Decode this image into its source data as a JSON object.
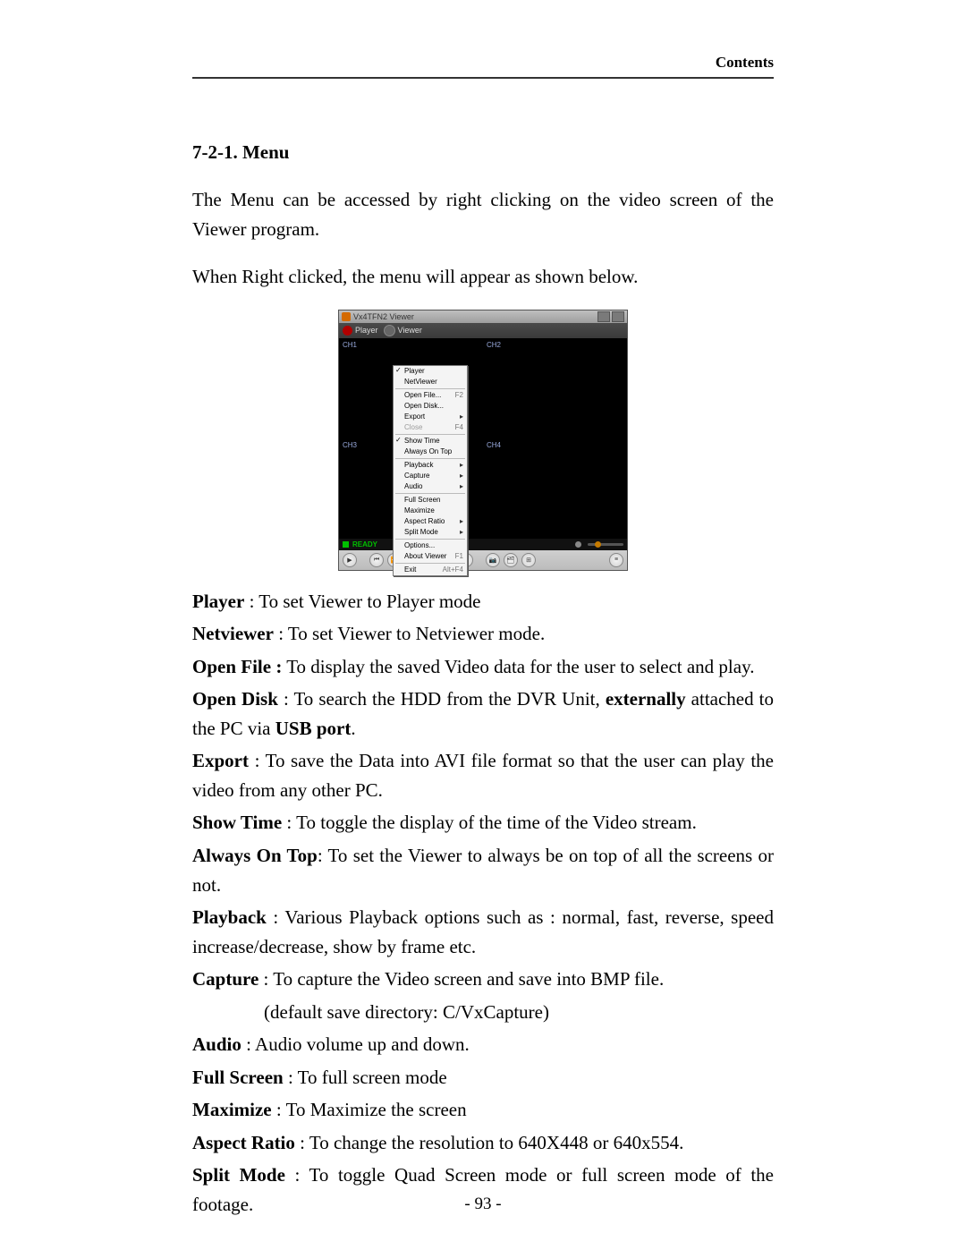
{
  "header": {
    "contents": "Contents"
  },
  "section": {
    "number": "7",
    "title": "-2-1. Menu"
  },
  "para1": "The Menu can be accessed by right clicking on the video screen of the Viewer program.",
  "para2": "When Right clicked, the menu will appear as shown below.",
  "viewer": {
    "title": "Vx4TFN2 Viewer",
    "toolbar": {
      "player": "Player",
      "viewer": "Viewer"
    },
    "channels": {
      "ch1": "CH1",
      "ch2": "CH2",
      "ch3": "CH3",
      "ch4": "CH4"
    },
    "status": {
      "ready": "READY"
    }
  },
  "menu": {
    "player": "Player",
    "netviewer": "NetViewer",
    "openfile": "Open File...",
    "openfile_sc": "F2",
    "opendisk": "Open Disk...",
    "export": "Export",
    "close": "Close",
    "close_sc": "F4",
    "showtime": "Show Time",
    "alwaysontop": "Always On Top",
    "playback": "Playback",
    "capture": "Capture",
    "audio": "Audio",
    "fullscreen": "Full Screen",
    "maximize": "Maximize",
    "aspectratio": "Aspect Ratio",
    "splitmode": "Split Mode",
    "options": "Options...",
    "aboutviewer": "About Viewer",
    "aboutviewer_sc": "F1",
    "exit": "Exit",
    "exit_sc": "Alt+F4"
  },
  "defs": {
    "player_b": "Player",
    "player_t": " : To set Viewer to Player mode",
    "netviewer_b": "Netviewer",
    "netviewer_t": " : To set Viewer to Netviewer mode.",
    "openfile_b": "Open File :",
    "openfile_t": " To display the saved Video data for the user to select and play.",
    "opendisk_b": "Open Disk",
    "opendisk_t1": " : To search the HDD from the DVR Unit, ",
    "opendisk_ext": "externally",
    "opendisk_t2": " attached to the PC via ",
    "opendisk_usb": "USB port",
    "opendisk_t3": ".",
    "export_b": "Export",
    "export_t": " : To save the Data into AVI file format so that the user can play the video from any other PC.",
    "showtime_b": "Show Time",
    "showtime_t": " : To toggle the display of the time of the Video stream.",
    "alwaysontop_b": "Always On Top",
    "alwaysontop_t": ": To set the Viewer to always be on top of all the screens or not.",
    "playback_b": "Playback",
    "playback_t": " : Various Playback options such as : normal, fast, reverse, speed increase/decrease, show by frame etc.",
    "capture_b": "Capture",
    "capture_t": " : To capture the Video screen and save into BMP file.",
    "capture_note": "(default save directory: C/VxCapture)",
    "audio_b": "Audio",
    "audio_t": " : Audio volume up and down.",
    "fullscreen_b": "Full Screen",
    "fullscreen_t": " : To full screen mode",
    "maximize_b": "Maximize",
    "maximize_t": " : To Maximize the screen",
    "aspect_b": "Aspect Ratio",
    "aspect_t": " : To change the resolution to 640X448 or 640x554.",
    "split_b": "Split Mode",
    "split_t": " : To toggle Quad Screen mode or full screen mode of the footage."
  },
  "pagenum": "- 93 -"
}
